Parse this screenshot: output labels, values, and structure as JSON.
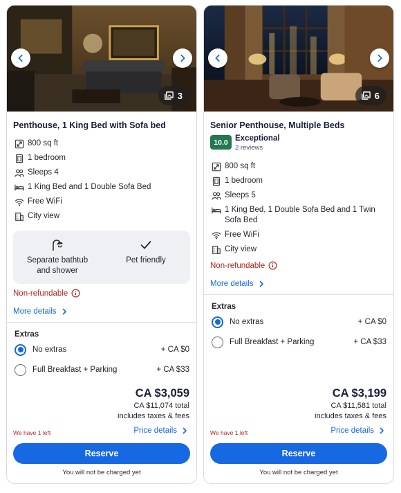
{
  "colors": {
    "accent": "#1668e3",
    "alert": "#b3261e",
    "score_bg": "#227950",
    "amenity_bg": "#eef0f4"
  },
  "cards": [
    {
      "title": "Penthouse, 1 King Bed with Sofa bed",
      "photo_count": "3",
      "features": [
        {
          "icon": "floor-area-icon",
          "text": "800 sq ft"
        },
        {
          "icon": "door-icon",
          "text": "1 bedroom"
        },
        {
          "icon": "people-icon",
          "text": "Sleeps 4"
        },
        {
          "icon": "bed-icon",
          "text": "1 King Bed and 1 Double Sofa Bed"
        },
        {
          "icon": "wifi-icon",
          "text": "Free WiFi"
        },
        {
          "icon": "building-icon",
          "text": "City view"
        }
      ],
      "amenities": [
        {
          "icon": "shower-icon",
          "text": "Separate bathtub and shower"
        },
        {
          "icon": "checkmark-icon",
          "text": "Pet friendly"
        }
      ],
      "refund": "Non-refundable",
      "more_details": "More details",
      "extras_title": "Extras",
      "options": [
        {
          "label": "No extras",
          "price": "+ CA $0",
          "selected": true
        },
        {
          "label": "Full Breakfast + Parking",
          "price": "+ CA $33",
          "selected": false
        }
      ],
      "price": "CA $3,059",
      "total": "CA $11,074 total",
      "taxes": "includes taxes & fees",
      "availability": "We have 1 left",
      "price_details": "Price details",
      "reserve": "Reserve",
      "note": "You will not be charged yet"
    },
    {
      "title": "Senior Penthouse, Multiple Beds",
      "photo_count": "6",
      "rating": {
        "score": "10.0",
        "label": "Exceptional",
        "reviews": "2 reviews"
      },
      "features": [
        {
          "icon": "floor-area-icon",
          "text": "800 sq ft"
        },
        {
          "icon": "door-icon",
          "text": "1 bedroom"
        },
        {
          "icon": "people-icon",
          "text": "Sleeps 5"
        },
        {
          "icon": "bed-icon",
          "text": "1 King Bed, 1 Double Sofa Bed and 1 Twin Sofa Bed"
        },
        {
          "icon": "wifi-icon",
          "text": "Free WiFi"
        },
        {
          "icon": "building-icon",
          "text": "City view"
        }
      ],
      "refund": "Non-refundable",
      "more_details": "More details",
      "extras_title": "Extras",
      "options": [
        {
          "label": "No extras",
          "price": "+ CA $0",
          "selected": true
        },
        {
          "label": "Full Breakfast + Parking",
          "price": "+ CA $33",
          "selected": false
        }
      ],
      "price": "CA $3,199",
      "total": "CA $11,581 total",
      "taxes": "includes taxes & fees",
      "availability": "We have 1 left",
      "price_details": "Price details",
      "reserve": "Reserve",
      "note": "You will not be charged yet"
    }
  ]
}
